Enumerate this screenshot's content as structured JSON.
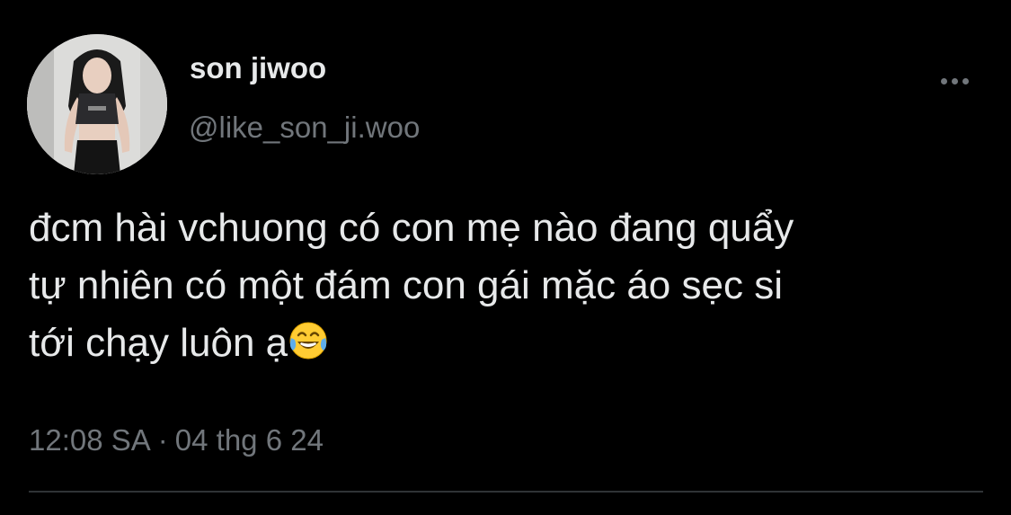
{
  "user": {
    "display_name": "son jiwoo",
    "handle": "@like_son_ji.woo"
  },
  "tweet": {
    "line1": "đcm hài vchuong có con mẹ nào đang quẩy",
    "line2": "tự nhiên có một đám con gái mặc áo sẹc si",
    "line3": "tới chạy luôn ạ",
    "emoji": "face-with-tears-of-joy",
    "time": "12:08 SA",
    "separator": "·",
    "date": "04 thg 6 24"
  },
  "colors": {
    "background": "#000000",
    "text_primary": "#e7e9ea",
    "text_secondary": "#71767b",
    "divider": "#2f3336"
  }
}
